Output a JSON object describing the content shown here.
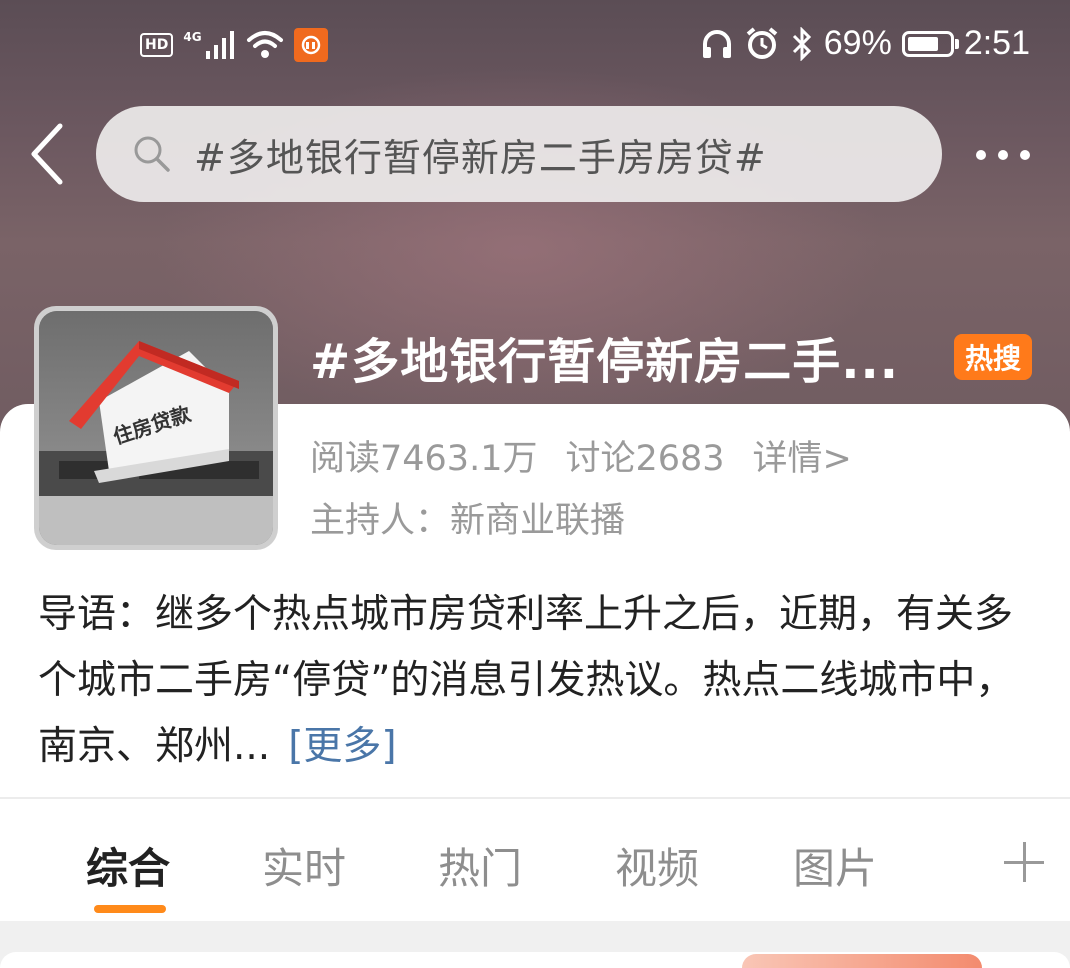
{
  "status_bar": {
    "hd": "HD",
    "network": "4G",
    "battery": "69%",
    "time": "2:51",
    "icons": [
      "hd-icon",
      "signal-icon",
      "wifi-icon",
      "mi-app-icon",
      "headphones-icon",
      "alarm-icon",
      "bluetooth-icon",
      "battery-icon"
    ]
  },
  "nav": {
    "search_query": "#多地银行暂停新房二手房房贷#",
    "icons": [
      "back-icon",
      "search-icon",
      "more-icon"
    ]
  },
  "topic": {
    "title": "#多地银行暂停新房二手...",
    "badge": "热搜",
    "reads": "阅读7463.1万",
    "discussions": "讨论2683",
    "detail_link": "详情>",
    "host": "主持人：新商业联播",
    "thumbnail_sign": "住房贷款",
    "intro_prefix": "导语：继多个热点城市房贷利率上升之后，近期，有关多个城市二手房“停贷”的消息引发热议。热点二线城市中，南京、郑州...",
    "intro_more": "[更多]"
  },
  "tabs": {
    "items": [
      "综合",
      "实时",
      "热门",
      "视频",
      "图片"
    ],
    "active": "综合"
  },
  "colors": {
    "accent_orange": "#ff8a1a",
    "hot_badge": "#ff7a1a",
    "link_blue": "#4a76a8"
  }
}
